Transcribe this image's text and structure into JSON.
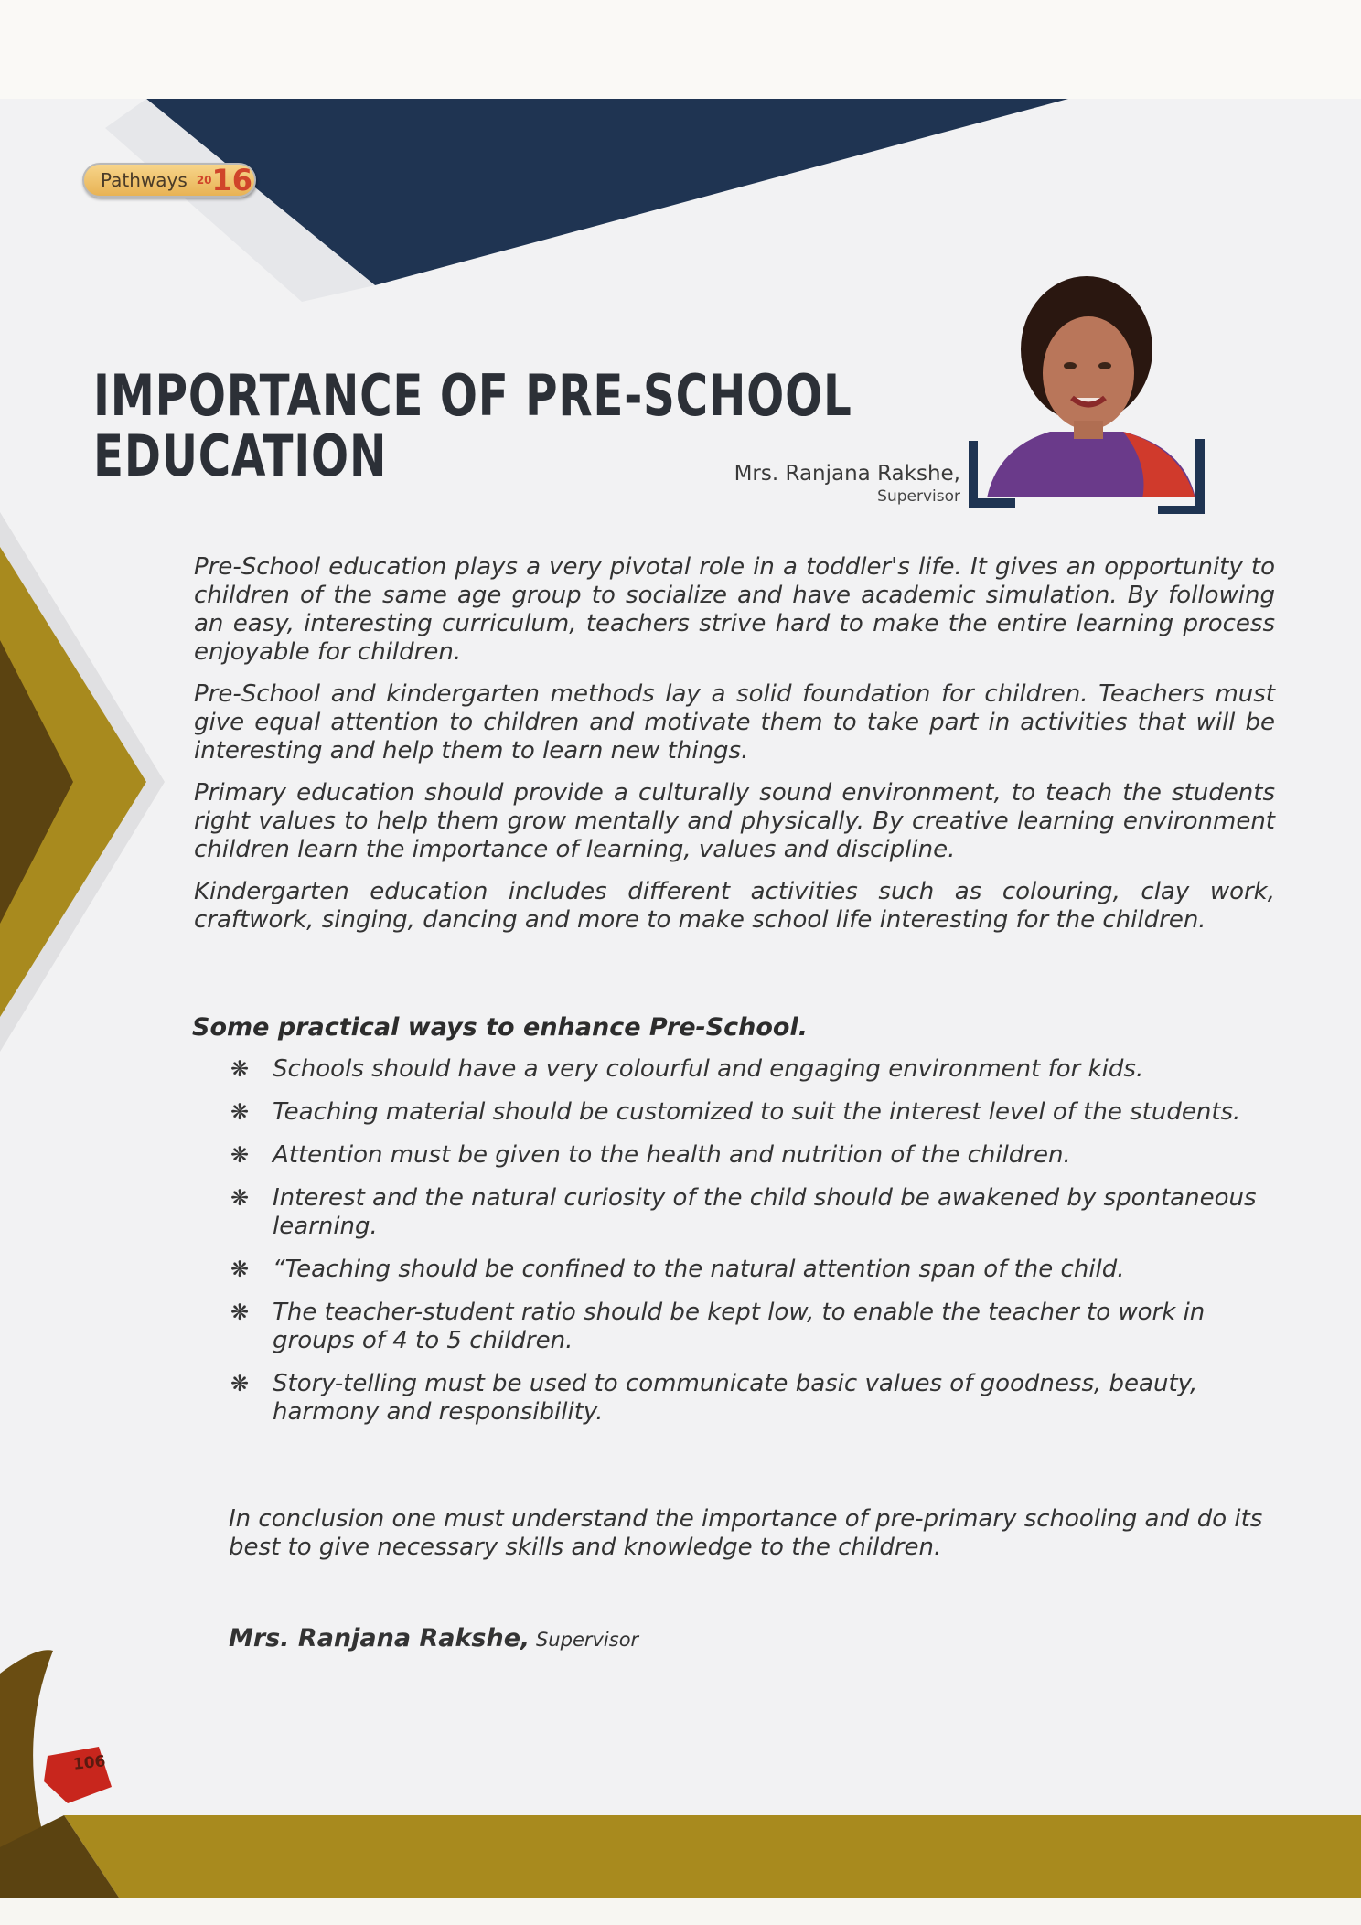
{
  "badge": {
    "label": "Pathways",
    "year_prefix": "20",
    "year_suffix": "16"
  },
  "title": {
    "line1": "IMPORTANCE OF PRE-SCHOOL",
    "line2": "EDUCATION"
  },
  "author_header": {
    "name": "Mrs. Ranjana Rakshe,",
    "role": "Supervisor"
  },
  "paragraphs": [
    "Pre-School education plays a very pivotal role in a toddler's life. It gives an opportunity to children of the same age group to socialize and have academic simulation. By following an easy, interesting curriculum, teachers strive hard to make the entire learning process enjoyable for children.",
    "Pre-School and kindergarten methods lay a solid foundation for children. Teachers must give equal attention to children and motivate them to take part in activities that will be interesting and help them to learn new things.",
    "Primary education should provide a culturally sound environment, to teach the students right values to help them grow mentally and physically. By creative learning environment children learn the importance of learning, values and discipline.",
    "Kindergarten education includes different activities such as colouring, clay work, craftwork, singing, dancing and more to make school life interesting for the children."
  ],
  "tips_heading": "Some practical ways to enhance Pre-School.",
  "bullet_symbol": "❋",
  "tips": [
    "Schools should have a very colourful and engaging environment for kids.",
    "Teaching material should be customized to suit the interest level of the students.",
    "Attention must be given to the health and nutrition of the children.",
    "Interest and the natural curiosity of the child should be awakened by spontaneous learning.",
    "“Teaching should be confined to the natural attention span of the child.",
    "The teacher-student ratio should be kept low, to enable the teacher to work in groups of 4 to 5 children.",
    "Story-telling must be used to communicate basic values of goodness, beauty, harmony and responsibility."
  ],
  "conclusion": "In conclusion one must understand the importance of pre-primary schooling and do its best to give necessary skills and knowledge to the children.",
  "signoff": {
    "name": "Mrs. Ranjana Rakshe,",
    "role": " Supervisor"
  },
  "page_number": "106",
  "colors": {
    "navy": "#1f3452",
    "gold": "#a88a1e",
    "dark_brown": "#5b4311",
    "red_page_tab": "#c8261d",
    "text": "#333333"
  },
  "icons": {
    "portrait": "portrait-photo",
    "bullet": "asterisk-flower-icon"
  }
}
